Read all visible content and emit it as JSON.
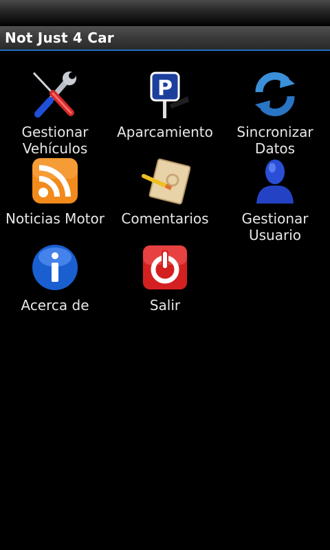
{
  "app": {
    "title": "Not Just 4 Car"
  },
  "menu": {
    "items": [
      {
        "label_line1": "Gestionar",
        "label_line2": "Vehículos",
        "icon": "tools-icon"
      },
      {
        "label_line1": "Aparcamiento",
        "label_line2": "",
        "icon": "parking-sign-icon"
      },
      {
        "label_line1": "Sincronizar",
        "label_line2": "Datos",
        "icon": "sync-icon"
      },
      {
        "label_line1": "Noticias Motor",
        "label_line2": "",
        "icon": "rss-icon"
      },
      {
        "label_line1": "Comentarios",
        "label_line2": "",
        "icon": "notebook-pencil-icon"
      },
      {
        "label_line1": "Gestionar",
        "label_line2": "Usuario",
        "icon": "user-icon"
      },
      {
        "label_line1": "Acerca de",
        "label_line2": "",
        "icon": "info-icon"
      },
      {
        "label_line1": "Salir",
        "label_line2": "",
        "icon": "power-icon"
      }
    ]
  },
  "colors": {
    "accent": "#1f6fb8",
    "rss": "#f28a1c",
    "exit": "#d42020",
    "info": "#1a5fd0",
    "user": "#2a4fd6"
  }
}
